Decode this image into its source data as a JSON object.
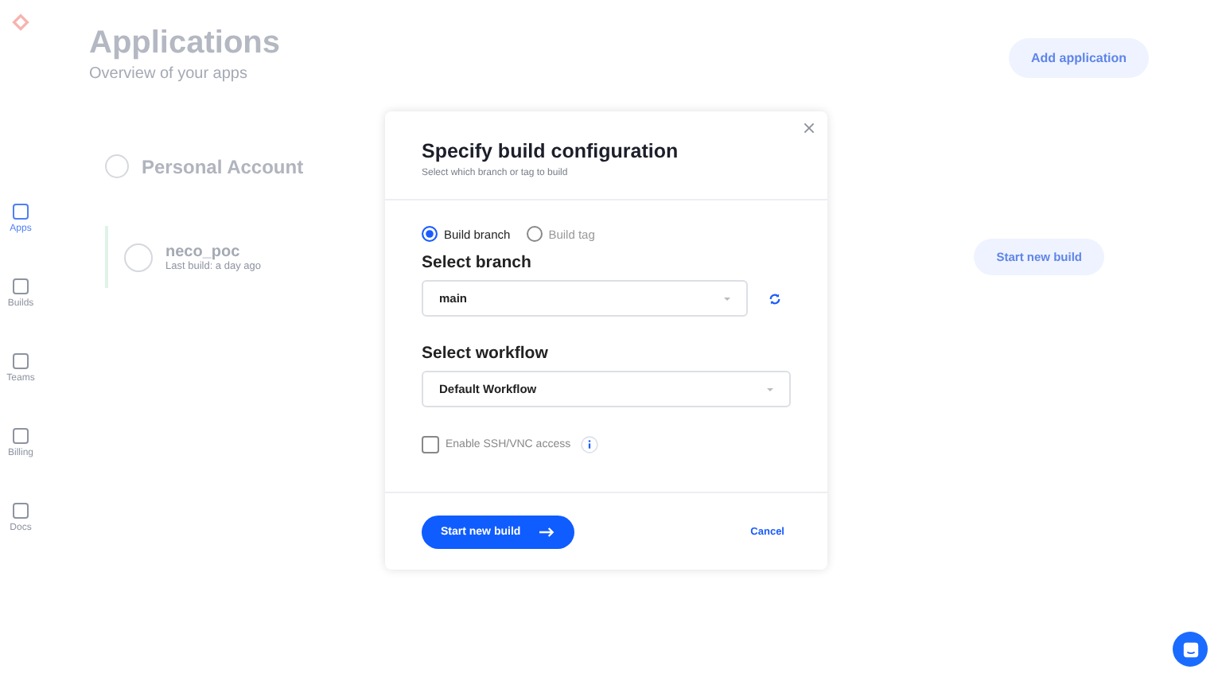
{
  "sidebar": {
    "items": [
      {
        "label": "Apps",
        "selected": true
      },
      {
        "label": "Builds",
        "selected": false
      },
      {
        "label": "Teams",
        "selected": false
      },
      {
        "label": "Billing",
        "selected": false
      },
      {
        "label": "Docs",
        "selected": false
      }
    ]
  },
  "page": {
    "title": "Applications",
    "subtitle": "Overview of your apps",
    "add_button": "Add application"
  },
  "account": {
    "name": "Personal Account"
  },
  "app": {
    "name": "neco_poc",
    "last_build": "Last build: a day ago",
    "start_button": "Start new build"
  },
  "modal": {
    "title": "Specify build configuration",
    "subtitle": "Select which branch or tag to build",
    "build_types": [
      {
        "label": "Build branch",
        "selected": true
      },
      {
        "label": "Build tag",
        "selected": false
      }
    ],
    "branch": {
      "label": "Select branch",
      "value": "main"
    },
    "workflow": {
      "label": "Select workflow",
      "value": "Default Workflow"
    },
    "ssh": {
      "label": "Enable SSH/VNC access",
      "checked": false
    },
    "start_button": "Start new build",
    "cancel": "Cancel"
  }
}
